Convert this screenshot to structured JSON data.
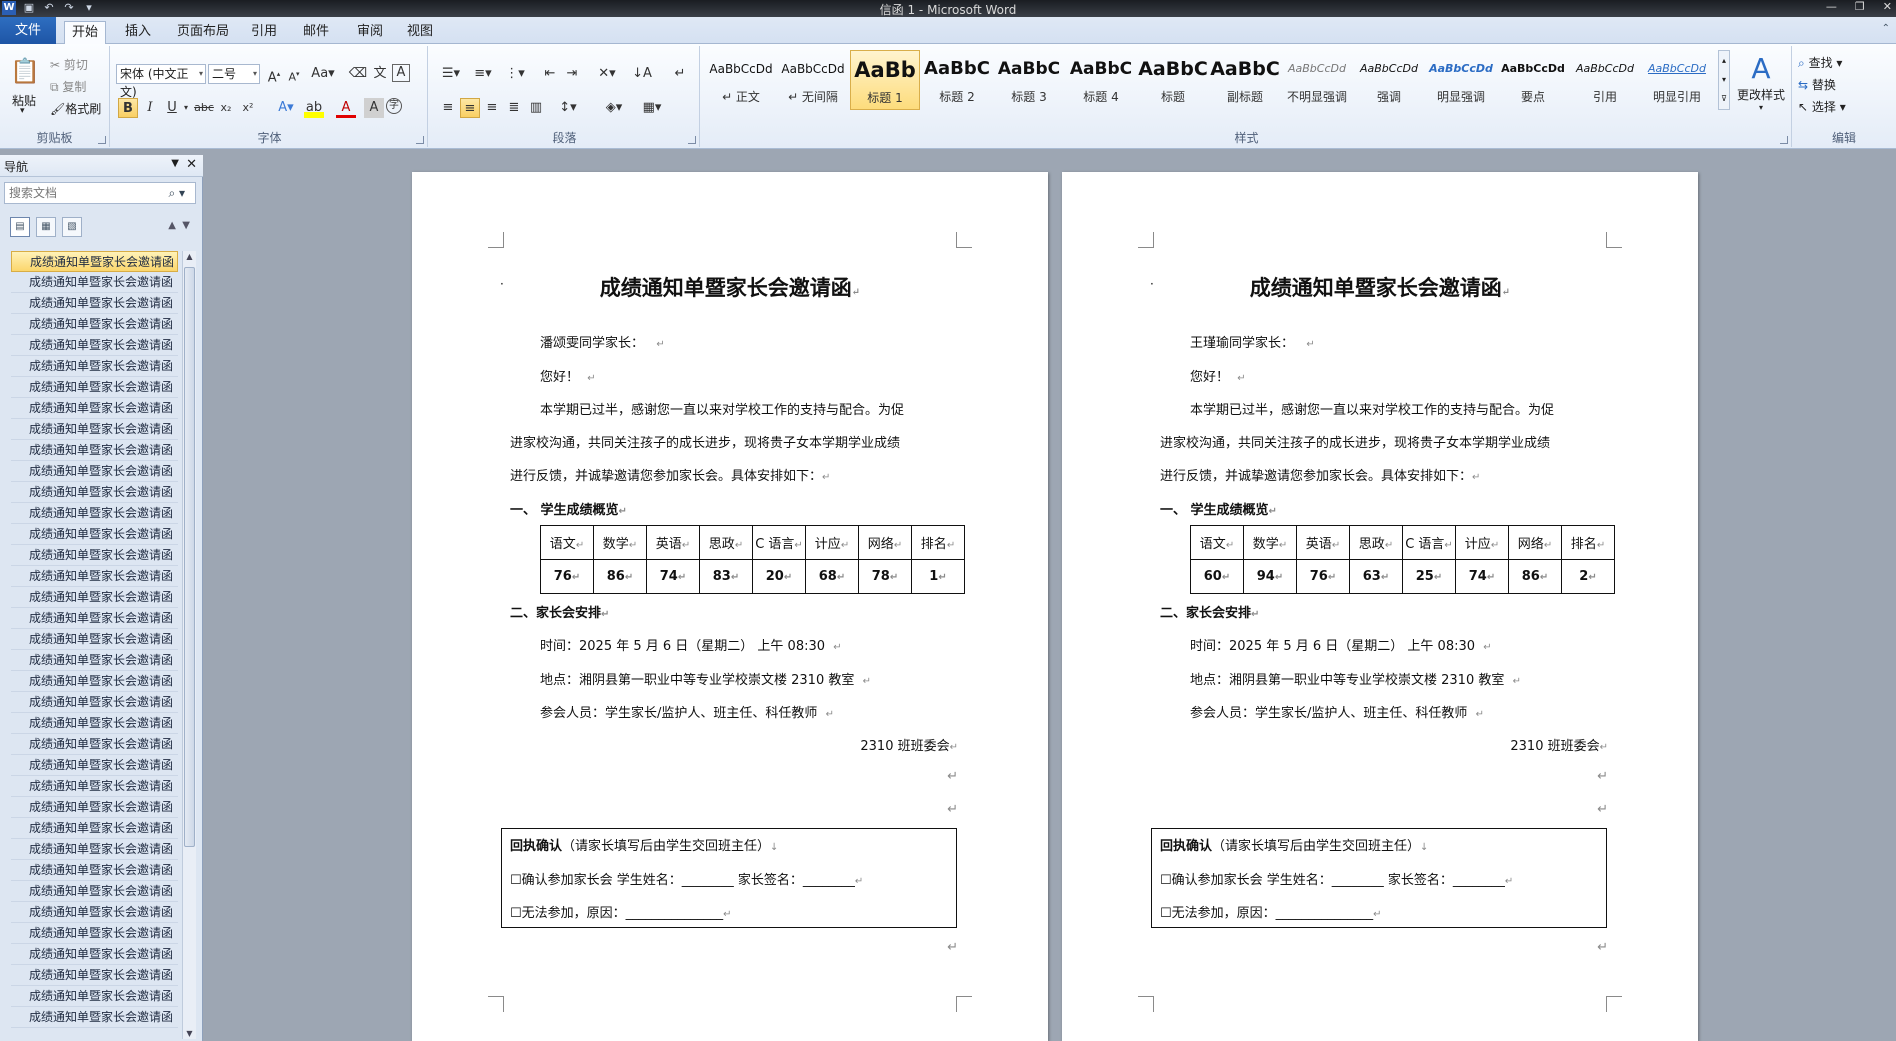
{
  "window": {
    "title": "信函 1 - Microsoft Word"
  },
  "tabs": [
    {
      "label": "文件",
      "key": "file"
    },
    {
      "label": "开始",
      "key": "home"
    },
    {
      "label": "插入",
      "key": "insert"
    },
    {
      "label": "页面布局",
      "key": "layout"
    },
    {
      "label": "引用",
      "key": "references"
    },
    {
      "label": "邮件",
      "key": "mailings"
    },
    {
      "label": "审阅",
      "key": "review"
    },
    {
      "label": "视图",
      "key": "view"
    }
  ],
  "ribbon": {
    "clipboard": {
      "paste": "粘贴",
      "cut": "剪切",
      "copy": "复制",
      "format_painter": "格式刷",
      "label": "剪贴板"
    },
    "font": {
      "name": "宋体 (中文正文)",
      "size": "二号",
      "label": "字体"
    },
    "paragraph": {
      "label": "段落"
    },
    "styles": {
      "label": "样式",
      "items": [
        {
          "sample": "AaBbCcDd",
          "name": "↵ 正文"
        },
        {
          "sample": "AaBbCcDd",
          "name": "↵ 无间隔"
        },
        {
          "sample": "AaBb",
          "name": "标题 1"
        },
        {
          "sample": "AaBbC",
          "name": "标题 2"
        },
        {
          "sample": "AaBbC",
          "name": "标题 3"
        },
        {
          "sample": "AaBbC",
          "name": "标题 4"
        },
        {
          "sample": "AaBbC",
          "name": "标题"
        },
        {
          "sample": "AaBbC",
          "name": "副标题"
        },
        {
          "sample": "AaBbCcDd",
          "name": "不明显强调"
        },
        {
          "sample": "AaBbCcDd",
          "name": "强调"
        },
        {
          "sample": "AaBbCcDd",
          "name": "明显强调"
        },
        {
          "sample": "AaBbCcDd",
          "name": "要点"
        },
        {
          "sample": "AaBbCcDd",
          "name": "引用"
        },
        {
          "sample": "AaBbCcDd",
          "name": "明显引用"
        }
      ],
      "change_styles": "更改样式"
    },
    "editing": {
      "find": "查找",
      "replace": "替换",
      "select": "选择",
      "label": "编辑"
    }
  },
  "nav": {
    "title": "导航",
    "search_placeholder": "搜索文档",
    "items": [
      "成绩通知单暨家长会邀请函",
      "成绩通知单暨家长会邀请函",
      "成绩通知单暨家长会邀请函",
      "成绩通知单暨家长会邀请函",
      "成绩通知单暨家长会邀请函",
      "成绩通知单暨家长会邀请函",
      "成绩通知单暨家长会邀请函",
      "成绩通知单暨家长会邀请函",
      "成绩通知单暨家长会邀请函",
      "成绩通知单暨家长会邀请函",
      "成绩通知单暨家长会邀请函",
      "成绩通知单暨家长会邀请函",
      "成绩通知单暨家长会邀请函",
      "成绩通知单暨家长会邀请函",
      "成绩通知单暨家长会邀请函",
      "成绩通知单暨家长会邀请函",
      "成绩通知单暨家长会邀请函",
      "成绩通知单暨家长会邀请函",
      "成绩通知单暨家长会邀请函",
      "成绩通知单暨家长会邀请函",
      "成绩通知单暨家长会邀请函",
      "成绩通知单暨家长会邀请函",
      "成绩通知单暨家长会邀请函",
      "成绩通知单暨家长会邀请函",
      "成绩通知单暨家长会邀请函",
      "成绩通知单暨家长会邀请函",
      "成绩通知单暨家长会邀请函",
      "成绩通知单暨家长会邀请函",
      "成绩通知单暨家长会邀请函",
      "成绩通知单暨家长会邀请函",
      "成绩通知单暨家长会邀请函",
      "成绩通知单暨家长会邀请函",
      "成绩通知单暨家长会邀请函",
      "成绩通知单暨家长会邀请函",
      "成绩通知单暨家长会邀请函",
      "成绩通知单暨家长会邀请函",
      "成绩通知单暨家长会邀请函"
    ]
  },
  "doc": {
    "title": "成绩通知单暨家长会邀请函",
    "greeting": "您好！",
    "intro1": "本学期已过半，感谢您一直以来对学校工作的支持与配合。为促",
    "intro2": "进家校沟通，共同关注孩子的成长进步，现将贵子女本学期学业成绩",
    "intro3": "进行反馈，并诚挚邀请您参加家长会。具体安排如下：",
    "section1": "一、  学生成绩概览",
    "subjects": [
      "语文",
      "数学",
      "英语",
      "思政",
      "C 语言",
      "计应",
      "网络",
      "排名"
    ],
    "section2": "二、家长会安排",
    "time": "时间：2025 年 5 月 6 日（星期二）  上午 08:30",
    "place": "地点：湘阴县第一职业中等专业学校崇文楼 2310 教室",
    "attendees": "参会人员：学生家长/监护人、班主任、科任教师",
    "signature": "2310 班班委会",
    "reply_title": "回执确认",
    "reply_note": "（请家长填写后由学生交回班主任）",
    "reply_opt1": "☐确认参加家长会  学生姓名：________ 家长签名：________",
    "reply_opt2": "☐无法参加，原因：_______________"
  },
  "pages": [
    {
      "addressee": "潘颂雯同学家长：",
      "scores": [
        "76",
        "86",
        "74",
        "83",
        "20",
        "68",
        "78",
        "1"
      ]
    },
    {
      "addressee": "王瑾瑜同学家长：",
      "scores": [
        "60",
        "94",
        "76",
        "63",
        "25",
        "74",
        "86",
        "2"
      ]
    }
  ]
}
